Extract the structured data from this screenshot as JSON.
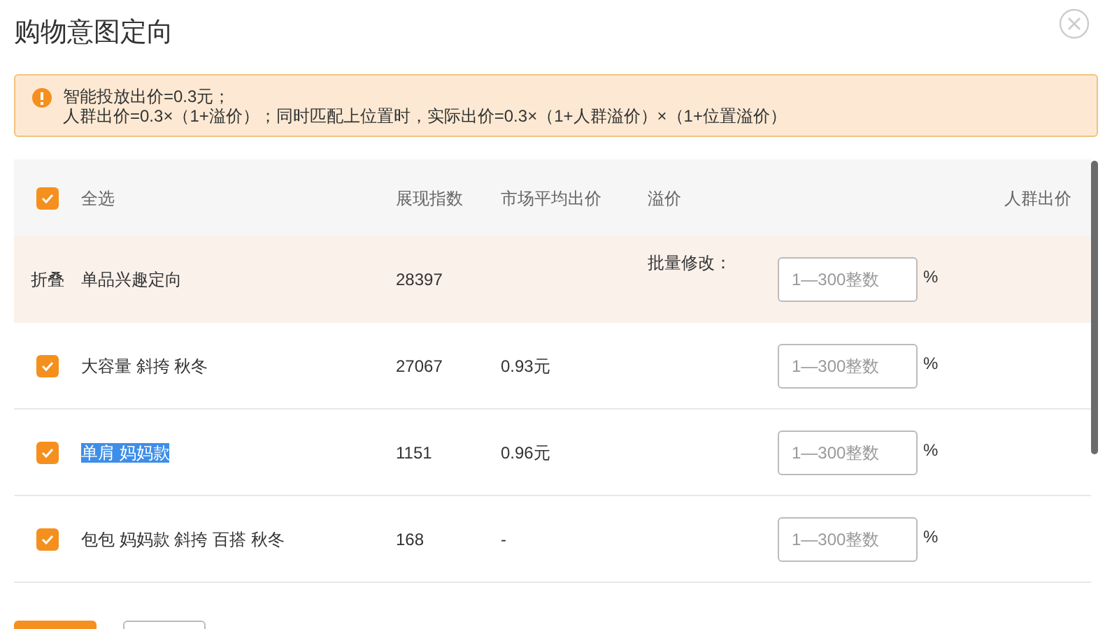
{
  "dialog": {
    "title": "购物意图定向"
  },
  "notice": {
    "lines": [
      "智能投放出价=0.3元；",
      "人群出价=0.3×（1+溢价）；同时匹配上位置时，实际出价=0.3×（1+人群溢价）×（1+位置溢价）"
    ]
  },
  "table": {
    "select_all": {
      "label": "全选",
      "checked": true
    },
    "columns": [
      "展现指数",
      "市场平均出价",
      "溢价",
      "人群出价"
    ],
    "group": {
      "toggle": "折叠",
      "name": "单品兴趣定向",
      "impressions": "28397",
      "batch_label": "批量修改：",
      "input": {
        "placeholder": "1—300整数"
      },
      "unit": "%"
    },
    "rows": [
      {
        "checked": true,
        "name": "大容量 斜挎 秋冬",
        "text_selected": false,
        "impressions": "27067",
        "avg_bid": "0.93元",
        "input": {
          "placeholder": "1—300整数"
        },
        "unit": "%"
      },
      {
        "checked": true,
        "name": "单肩 妈妈款",
        "text_selected": true,
        "impressions": "1151",
        "avg_bid": "0.96元",
        "input": {
          "placeholder": "1—300整数"
        },
        "unit": "%"
      },
      {
        "checked": true,
        "name": "包包 妈妈款 斜挎 百搭 秋冬",
        "text_selected": false,
        "impressions": "168",
        "avg_bid": "-",
        "input": {
          "placeholder": "1—300整数"
        },
        "unit": "%"
      }
    ]
  }
}
